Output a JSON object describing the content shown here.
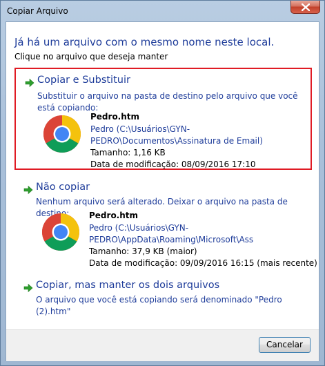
{
  "window": {
    "title": "Copiar Arquivo"
  },
  "header": {
    "title": "Já há um arquivo com o mesmo nome neste local.",
    "subtitle": "Clique no arquivo que deseja manter"
  },
  "options": [
    {
      "title": "Copiar e Substituir",
      "description": "Substituir o arquivo na pasta de destino pelo arquivo que você está copiando:",
      "file": {
        "name": "Pedro.htm",
        "path": "Pedro (C:\\Usuários\\GYN-PEDRO\\Documentos\\Assinatura de Email)",
        "size": "Tamanho: 1,16 KB",
        "date": "Data de modificação: 08/09/2016 17:10"
      }
    },
    {
      "title": "Não copiar",
      "description": "Nenhum arquivo será alterado. Deixar o arquivo na pasta de destino:",
      "file": {
        "name": "Pedro.htm",
        "path": "Pedro (C:\\Usuários\\GYN-PEDRO\\AppData\\Roaming\\Microsoft\\Ass",
        "size": "Tamanho: 37,9 KB (maior)",
        "date": "Data de modificação: 09/09/2016 16:15 (mais recente)"
      }
    },
    {
      "title": "Copiar, mas manter os dois arquivos",
      "description": "O arquivo que você está copiando será denominado \"Pedro (2).htm\""
    }
  ],
  "footer": {
    "cancel_label": "Cancelar"
  },
  "colors": {
    "accent": "#1e3c9a",
    "selection_border": "#e01b24",
    "arrow": "#2e9e2e"
  },
  "icons": {
    "option_arrow": "green-arrow-icon",
    "file": "chrome-icon",
    "close": "close-icon"
  }
}
